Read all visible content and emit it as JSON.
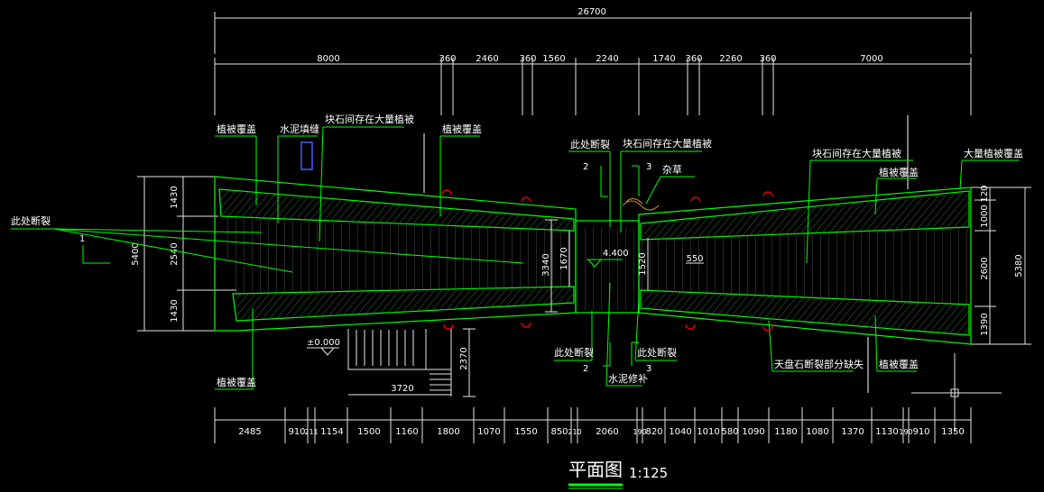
{
  "drawing": {
    "title": "平面图",
    "scale": "1:125"
  },
  "dimensions": {
    "overall_top": "26700",
    "top_row": [
      "8000",
      "360",
      "2460",
      "360",
      "1560",
      "2240",
      "1740",
      "360",
      "2260",
      "360",
      "7000"
    ],
    "left_column": [
      "1430",
      "2540",
      "1430"
    ],
    "left_total": "5400",
    "right_column": [
      "120",
      "1000",
      "2600",
      "1390"
    ],
    "right_total": "5380",
    "center_span": "3340",
    "center_inner_left": "1670",
    "center_inner_right": "1520",
    "center_small": "550",
    "stair_depth": "2370",
    "stair_width": "3720",
    "bottom_row": [
      "2485",
      "910",
      "211",
      "1154",
      "1500",
      "1160",
      "1800",
      "1070",
      "1550",
      "850",
      "210",
      "2060",
      "190",
      "820",
      "1040",
      "1010",
      "580",
      "1090",
      "1180",
      "1080",
      "1370",
      "1130",
      "190",
      "910",
      "1350"
    ]
  },
  "elevations": {
    "stair_level": "±0.000",
    "center_level": "4.400"
  },
  "section_marks": {
    "s1": "1",
    "s2_top": "2",
    "s3_top": "3",
    "s2_bottom": "2",
    "s3_bottom": "3"
  },
  "annotations": {
    "vegetation_cover_a": "植被覆盖",
    "cement_joint": "水泥填缝",
    "rock_gap_veg_a": "块石间存在大量植被",
    "vegetation_cover_b": "植被覆盖",
    "break_here_left": "此处断裂",
    "break_here_top": "此处断裂",
    "rock_gap_veg_b": "块石间存在大量植被",
    "weeds": "杂草",
    "rock_gap_veg_c": "块石间存在大量植被",
    "vegetation_cover_c": "植被覆盖",
    "heavy_vegetation": "大量植被覆盖",
    "vegetation_cover_bottom_left": "植被覆盖",
    "break_here_bottom_a": "此处断裂",
    "break_here_bottom_b": "此处断裂",
    "cement_repair": "水泥修补",
    "partial_loss": "天盘石断裂部分缺失",
    "vegetation_cover_bottom_right": "植被覆盖"
  },
  "colors": {
    "dimension_lines": "#ffffff",
    "outline": "#00ff00",
    "leader": "#00ff00",
    "marker": "#ff0000",
    "symbol": "#0000ff"
  }
}
